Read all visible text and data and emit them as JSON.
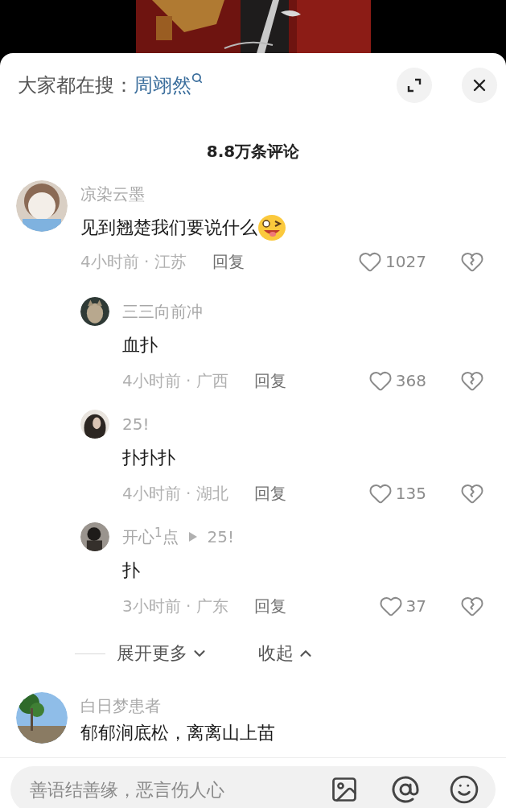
{
  "header": {
    "label": "大家都在搜：",
    "search_term": "周翊然"
  },
  "title": "8.8万条评论",
  "comments": [
    {
      "name": "凉染云墨",
      "text": "见到翘楚我们要说什么",
      "emoji": true,
      "meta": "4小时前 · 江苏",
      "reply": "回复",
      "likes": "1027",
      "replies": [
        {
          "name": "三三向前冲",
          "text": "血扑",
          "meta": "4小时前 · 广西",
          "reply": "回复",
          "likes": "368"
        },
        {
          "name": "25!",
          "text": "扑扑扑",
          "meta": "4小时前 · 湖北",
          "reply": "回复",
          "likes": "135"
        },
        {
          "name": "开心$^{1}$点",
          "reply_to": "25!",
          "text": "扑",
          "meta": "3小时前 · 广东",
          "reply": "回复",
          "likes": "37"
        }
      ]
    },
    {
      "name": "白日梦患者",
      "text": "郁郁涧底松，离离山上苗"
    }
  ],
  "expand": {
    "more": "展开更多",
    "collapse": "收起"
  },
  "input": {
    "placeholder": "善语结善缘，恶言伤人心"
  }
}
